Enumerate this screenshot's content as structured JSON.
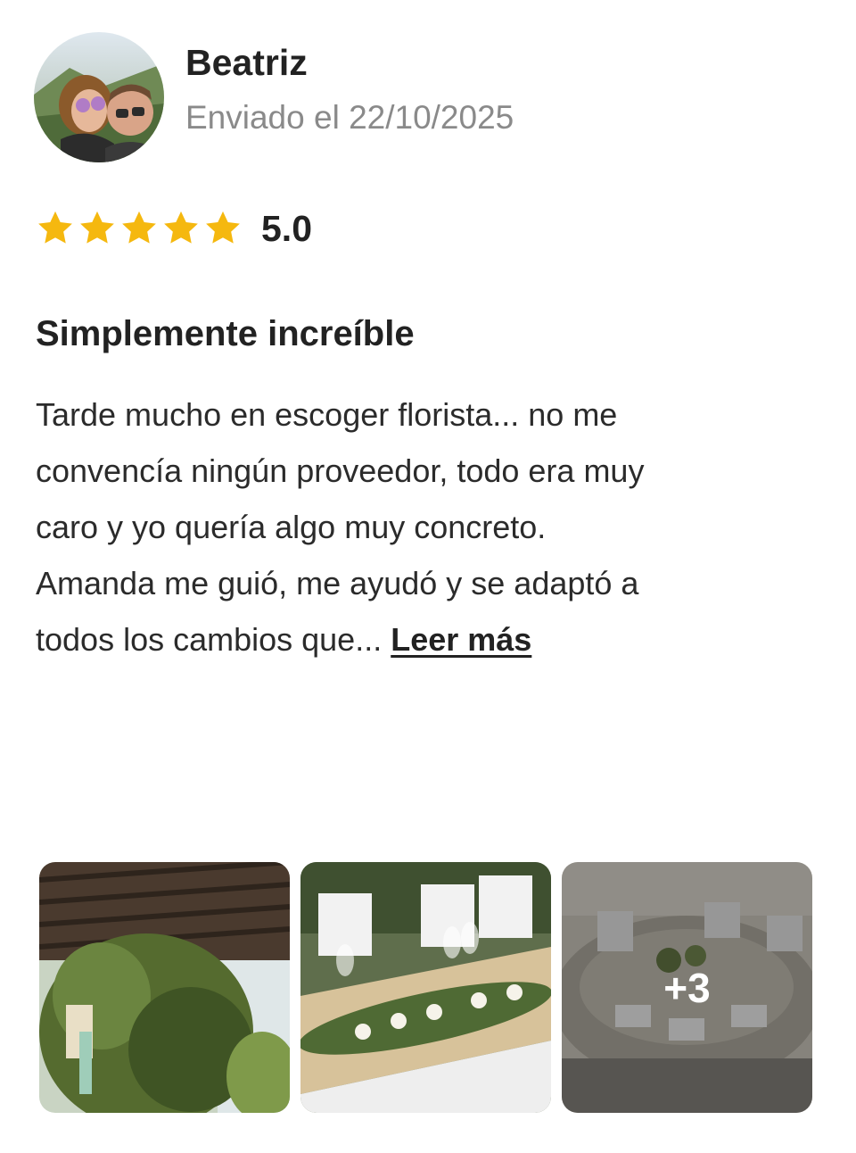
{
  "review": {
    "author": "Beatriz",
    "sent_date": "Enviado el 22/10/2025",
    "rating_value": "5.0",
    "rating_stars": 5,
    "title": "Simplemente increíble",
    "body_lines": [
      "Tarde mucho en escoger florista... no me",
      "convencía ningún proveedor, todo era muy",
      "caro y yo quería algo muy concreto.",
      "Amanda me guió, me ayudó y se adaptó a",
      "todos los cambios que..."
    ],
    "read_more": "Leer más"
  },
  "photos": {
    "items": [
      {
        "icon": "photo-greenery-pergola"
      },
      {
        "icon": "photo-table-flowers"
      },
      {
        "icon": "photo-round-tables"
      }
    ],
    "more_count": "+3"
  },
  "colors": {
    "star": "#F5B80F",
    "text_primary": "#222222",
    "text_secondary": "#8A8A8A"
  }
}
